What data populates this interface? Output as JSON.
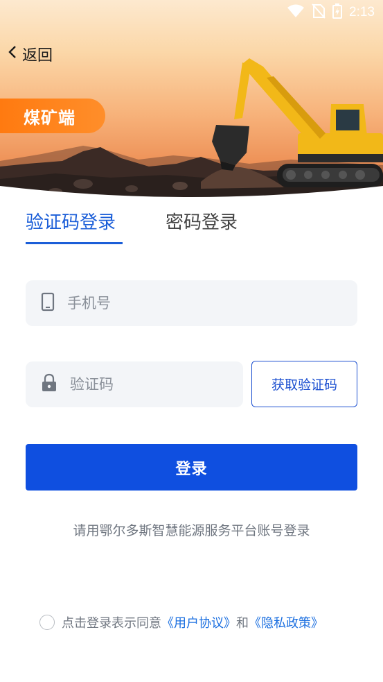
{
  "status_bar": {
    "time": "2:13"
  },
  "header": {
    "back_label": "返回",
    "role_badge": "煤矿端"
  },
  "tabs": [
    {
      "label": "验证码登录",
      "active": true
    },
    {
      "label": "密码登录",
      "active": false
    }
  ],
  "form": {
    "phone_placeholder": "手机号",
    "code_placeholder": "验证码",
    "get_code_label": "获取验证码",
    "login_label": "登录"
  },
  "hint": "请用鄂尔多斯智慧能源服务平台账号登录",
  "agreement": {
    "prefix": "点击登录表示同意",
    "user_agreement": "《用户协议》",
    "conjunction": "和",
    "privacy_policy": "《隐私政策》"
  },
  "colors": {
    "primary": "#0f4fe0",
    "accent_orange": "#ff7a10",
    "link": "#1b6fe0"
  }
}
